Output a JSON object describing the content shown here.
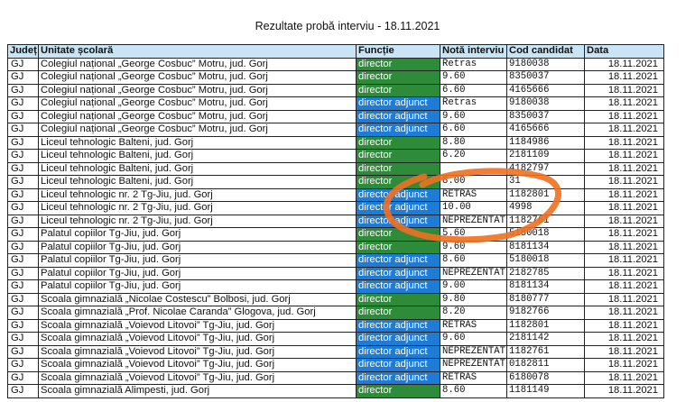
{
  "title": "Rezultate probă interviu - 18.11.2021",
  "colors": {
    "director": "#2e8b3a",
    "director_adjunct": "#1e7bd6",
    "header_bg": "#c9e4f4",
    "annotation": "#f07020"
  },
  "table": {
    "headers": [
      "Județ",
      "Unitate școlară",
      "Funcție",
      "Notă interviu",
      "Cod candidat",
      "Data"
    ],
    "rows": [
      {
        "judet": "GJ",
        "unitate": "Colegiul național „George Cosbuc” Motru, jud. Gorj",
        "functie": "director",
        "nota": "Retras",
        "cod": "9180038",
        "data": "18.11.2021"
      },
      {
        "judet": "GJ",
        "unitate": "Colegiul național „George Cosbuc” Motru, jud. Gorj",
        "functie": "director",
        "nota": "9.60",
        "cod": "8350037",
        "data": "18.11.2021"
      },
      {
        "judet": "GJ",
        "unitate": "Colegiul național „George Cosbuc” Motru, jud. Gorj",
        "functie": "director",
        "nota": "6.60",
        "cod": "4165666",
        "data": "18.11.2021"
      },
      {
        "judet": "GJ",
        "unitate": "Colegiul național „George Cosbuc” Motru, jud. Gorj",
        "functie": "director adjunct",
        "nota": "Retras",
        "cod": "9180038",
        "data": "18.11.2021"
      },
      {
        "judet": "GJ",
        "unitate": "Colegiul național „George Cosbuc” Motru, jud. Gorj",
        "functie": "director adjunct",
        "nota": "9.60",
        "cod": "8350037",
        "data": "18.11.2021"
      },
      {
        "judet": "GJ",
        "unitate": "Colegiul național „George Cosbuc” Motru, jud. Gorj",
        "functie": "director adjunct",
        "nota": "6.60",
        "cod": "4165666",
        "data": "18.11.2021"
      },
      {
        "judet": "GJ",
        "unitate": "Liceul tehnologic Balteni, jud. Gorj",
        "functie": "director",
        "nota": "8.80",
        "cod": "1184986",
        "data": "18.11.2021"
      },
      {
        "judet": "GJ",
        "unitate": "Liceul tehnologic Balteni, jud. Gorj",
        "functie": "director",
        "nota": "6.20",
        "cod": "2181109",
        "data": "18.11.2021"
      },
      {
        "judet": "GJ",
        "unitate": "Liceul tehnologic Balteni, jud. Gorj",
        "functie": "director",
        "nota": "",
        "cod": "4182797",
        "data": "18.11.2021"
      },
      {
        "judet": "GJ",
        "unitate": "Liceul tehnologic Balteni, jud. Gorj",
        "functie": "director",
        "nota": "8.00",
        "cod": "31",
        "data": "18.11.2021"
      },
      {
        "judet": "GJ",
        "unitate": "Liceul tehnologic nr. 2 Tg-Jiu, jud. Gorj",
        "functie": "director adjunct",
        "nota": "RETRAS",
        "cod": "1182801",
        "data": "18.11.2021"
      },
      {
        "judet": "GJ",
        "unitate": "Liceul tehnologic nr. 2 Tg-Jiu, jud. Gorj",
        "functie": "director adjunct",
        "nota": "10.00",
        "cod": "4998",
        "data": "18.11.2021"
      },
      {
        "judet": "GJ",
        "unitate": "Liceul tehnologic nr. 2 Tg-Jiu, jud. Gorj",
        "functie": "director adjunct",
        "nota": "NEPREZENTAT",
        "cod": "1182761",
        "data": "18.11.2021"
      },
      {
        "judet": "GJ",
        "unitate": "Palatul copiilor Tg-Jiu, jud. Gorj",
        "functie": "director",
        "nota": "5.60",
        "cod": "5180018",
        "data": "18.11.2021"
      },
      {
        "judet": "GJ",
        "unitate": "Palatul copiilor Tg-Jiu, jud. Gorj",
        "functie": "director",
        "nota": "9.60",
        "cod": "8181134",
        "data": "18.11.2021"
      },
      {
        "judet": "GJ",
        "unitate": "Palatul copiilor Tg-Jiu, jud. Gorj",
        "functie": "director adjunct",
        "nota": "8.60",
        "cod": "5180018",
        "data": "18.11.2021"
      },
      {
        "judet": "GJ",
        "unitate": "Palatul copiilor Tg-Jiu, jud. Gorj",
        "functie": "director adjunct",
        "nota": "NEPREZENTAT",
        "cod": "2182785",
        "data": "18.11.2021"
      },
      {
        "judet": "GJ",
        "unitate": "Palatul copiilor Tg-Jiu, jud. Gorj",
        "functie": "director adjunct",
        "nota": "9.00",
        "cod": "8181134",
        "data": "18.11.2021"
      },
      {
        "judet": "GJ",
        "unitate": "Scoala gimnazială „Nicolae Costescu” Bolbosi, jud. Gorj",
        "functie": "director",
        "nota": "9.80",
        "cod": "8180777",
        "data": "18.11.2021"
      },
      {
        "judet": "GJ",
        "unitate": "Scoala gimnazială „Prof. Nicolae Caranda” Glogova, jud. Gorj",
        "functie": "director",
        "nota": "8.20",
        "cod": "9182766",
        "data": "18.11.2021"
      },
      {
        "judet": "GJ",
        "unitate": "Scoala gimnazială „Voievod Litovoi” Tg-Jiu, jud. Gorj",
        "functie": "director adjunct",
        "nota": "RETRAS",
        "cod": "1182801",
        "data": "18.11.2021"
      },
      {
        "judet": "GJ",
        "unitate": "Scoala gimnazială „Voievod Litovoi” Tg-Jiu, jud. Gorj",
        "functie": "director adjunct",
        "nota": "9.60",
        "cod": "2181142",
        "data": "18.11.2021"
      },
      {
        "judet": "GJ",
        "unitate": "Scoala gimnazială „Voievod Litovoi” Tg-Jiu, jud. Gorj",
        "functie": "director adjunct",
        "nota": "NEPREZENTAT",
        "cod": "1182761",
        "data": "18.11.2021"
      },
      {
        "judet": "GJ",
        "unitate": "Scoala gimnazială „Voievod Litovoi” Tg-Jiu, jud. Gorj",
        "functie": "director adjunct",
        "nota": "NEPREZENTAT",
        "cod": "0182811",
        "data": "18.11.2021"
      },
      {
        "judet": "GJ",
        "unitate": "Scoala gimnazială „Voievod Litovoi” Tg-Jiu, jud. Gorj",
        "functie": "director adjunct",
        "nota": "RETRAS",
        "cod": "6180078",
        "data": "18.11.2021"
      },
      {
        "judet": "GJ",
        "unitate": "Scoala gimnazială Alimpesti, jud. Gorj",
        "functie": "director",
        "nota": "8.60",
        "cod": "1181149",
        "data": "18.11.2021"
      }
    ]
  }
}
